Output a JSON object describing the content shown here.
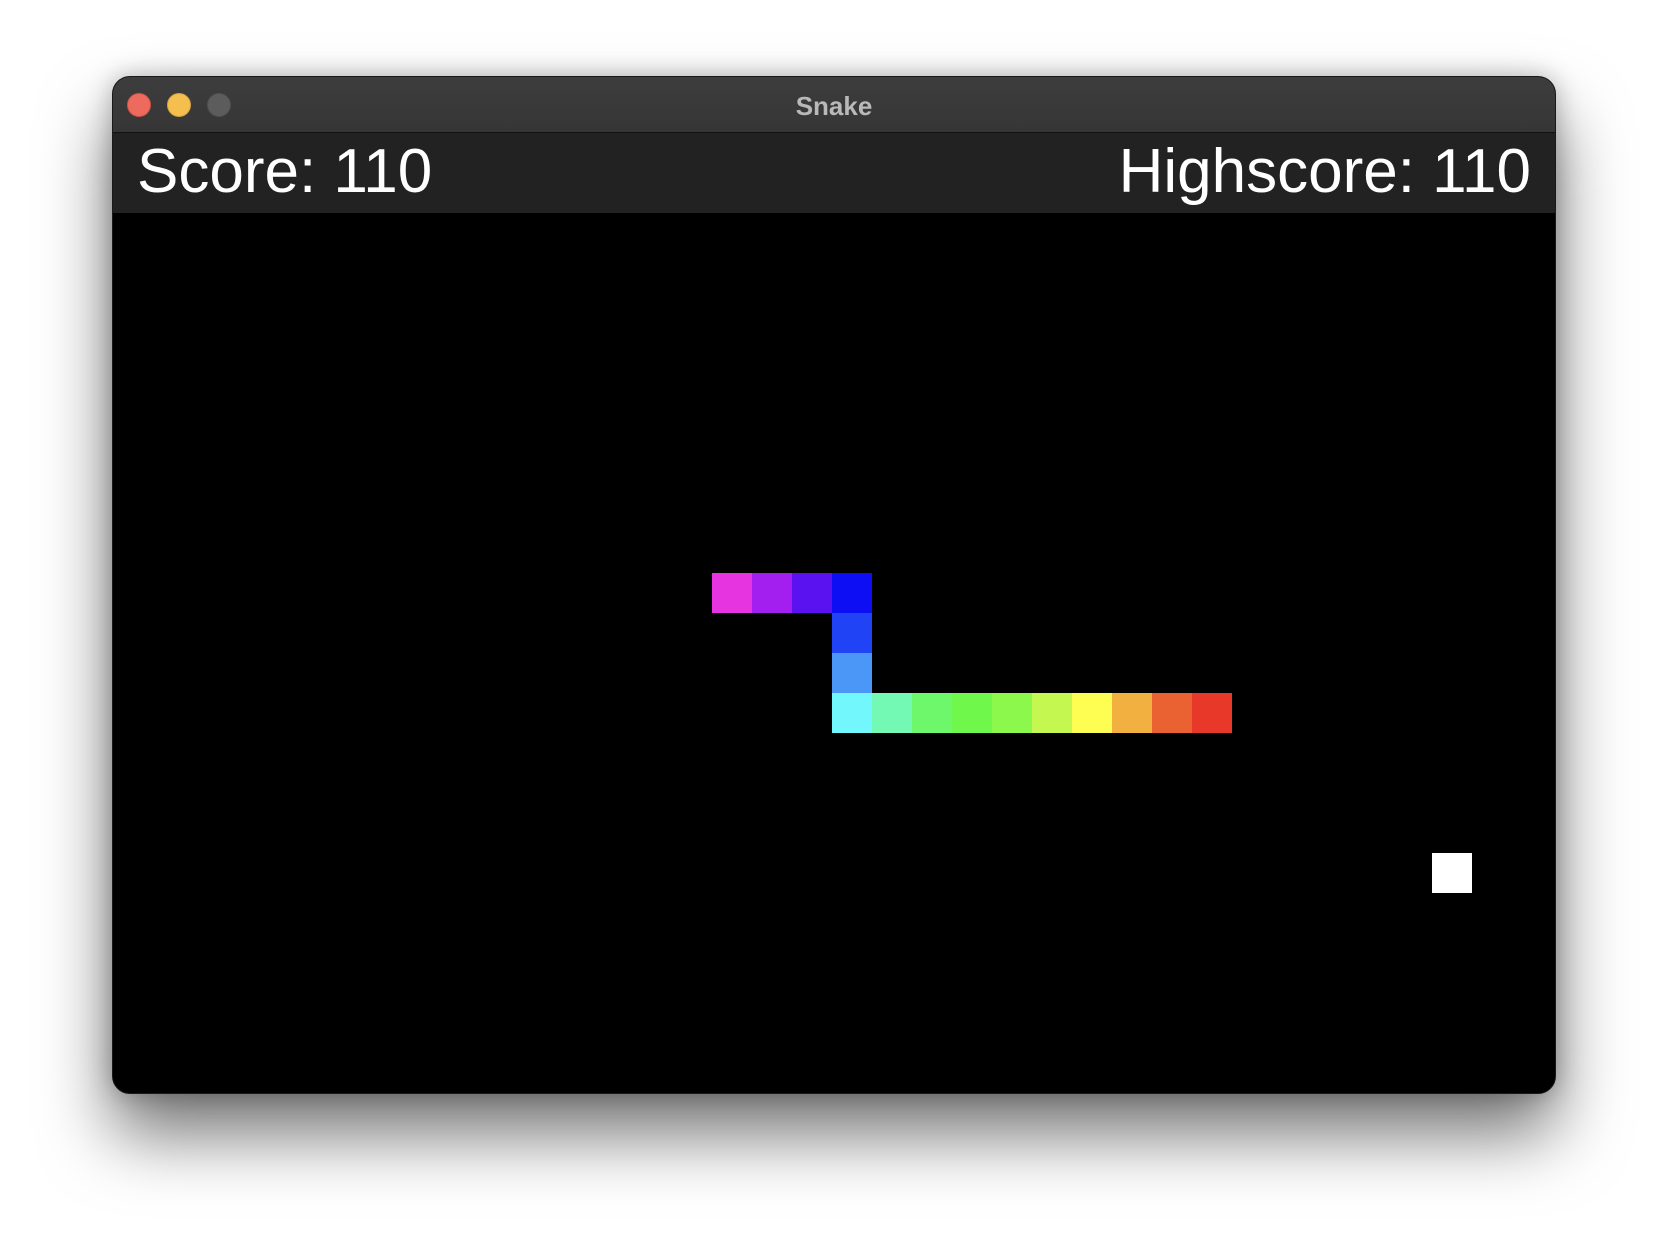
{
  "window": {
    "title": "Snake"
  },
  "scoreboard": {
    "score_text": "Score: 110",
    "highscore_text": "Highscore: 110"
  },
  "grid": {
    "cell_size": 40
  },
  "snake": {
    "segments": [
      {
        "col": 27,
        "row": 12,
        "color": "#e8382a"
      },
      {
        "col": 26,
        "row": 12,
        "color": "#ea6132"
      },
      {
        "col": 25,
        "row": 12,
        "color": "#f2b040"
      },
      {
        "col": 24,
        "row": 12,
        "color": "#fdfd52"
      },
      {
        "col": 23,
        "row": 12,
        "color": "#c4f74f"
      },
      {
        "col": 22,
        "row": 12,
        "color": "#8cf84c"
      },
      {
        "col": 21,
        "row": 12,
        "color": "#70f74b"
      },
      {
        "col": 20,
        "row": 12,
        "color": "#6ef76a"
      },
      {
        "col": 19,
        "row": 12,
        "color": "#73f9b3"
      },
      {
        "col": 18,
        "row": 12,
        "color": "#72f7fd"
      },
      {
        "col": 18,
        "row": 11,
        "color": "#4b97f8"
      },
      {
        "col": 18,
        "row": 10,
        "color": "#1f43f5"
      },
      {
        "col": 18,
        "row": 9,
        "color": "#0d0ef4"
      },
      {
        "col": 17,
        "row": 9,
        "color": "#5a12f0"
      },
      {
        "col": 16,
        "row": 9,
        "color": "#a21fef"
      },
      {
        "col": 15,
        "row": 9,
        "color": "#e534e0"
      }
    ]
  },
  "food": {
    "col": 33,
    "row": 16,
    "color": "#ffffff"
  }
}
